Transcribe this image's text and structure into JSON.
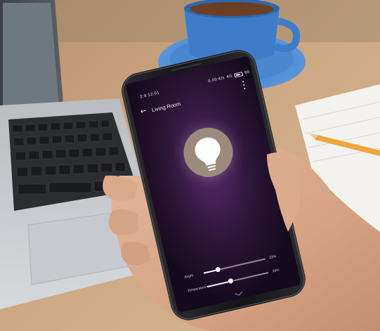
{
  "status_bar": {
    "time": "2:9 12:01",
    "network_speed": "0.00 K/s",
    "signal": "4G",
    "battery_level": "90"
  },
  "app_bar": {
    "back_icon": "arrow-left-icon",
    "title": "Living Room",
    "menu_icon": "more-vert-icon"
  },
  "light": {
    "power_icon": "lightbulb-icon",
    "accent_color": "#9c8b7c"
  },
  "controls": {
    "brightness": {
      "label": "Bright",
      "value": 0.23,
      "value_text": "23%"
    },
    "temperature": {
      "label": "Temperature",
      "value": 0.39,
      "value_text": "39%"
    }
  },
  "collapse_icon": "chevron-down-icon",
  "colors": {
    "screen_background": "#1c0f26",
    "screen_glow": "#5a2a6e",
    "slider_fill": "#f4f4f6",
    "slider_track": "#8f8a98"
  }
}
